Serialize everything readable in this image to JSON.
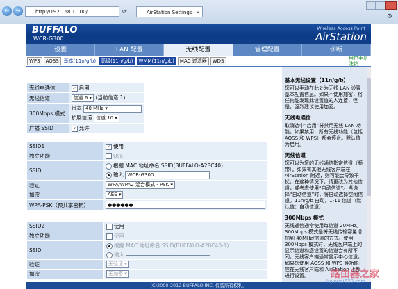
{
  "browser": {
    "back": "←",
    "forward": "→",
    "address": "http://192.168.1.100/",
    "tab_title": "AirStation Settings",
    "tab_close": "×"
  },
  "header": {
    "brand": "BUFFALO",
    "model": "WCR-G300",
    "product_sub": "Wireless Access Point",
    "product": "AirStation"
  },
  "tabs": [
    "设置",
    "LAN 配置",
    "无线配置",
    "管理配置",
    "诊断"
  ],
  "subtabs": [
    "WPS",
    "AOSS",
    "基本(11n/g/b)",
    "高级(11n/g/b)",
    "WMM(11n/g/b)",
    "MAC 过滤器",
    "WDS"
  ],
  "manual": {
    "line1": "用户手册",
    "line2": "注销"
  },
  "form": {
    "wireless_label": "无线电通信",
    "wireless_value": "启用",
    "channel_label": "无线信道",
    "channel_value": "信道 6",
    "channel_current": "(当前信道 1)",
    "mode300_label": "300Mbps 模式",
    "bandwidth_label": "带宽",
    "bandwidth_value": "40 MHz",
    "ext_channel_label": "扩展信道",
    "ext_channel_value": "信道 10",
    "broadcast_label": "广播 SSID",
    "broadcast_value": "允许",
    "ssid1_label": "SSID1",
    "ssid1_use": "使用",
    "isolation_label": "独立功能",
    "isolation_value": "Use",
    "ssid_label": "SSID",
    "ssid_opt_mac": "根据 MAC 地址命名 SSID(BUFFALO-A28C40)",
    "ssid_opt_input": "输入",
    "ssid_value": "WCR-G300",
    "auth_label": "验证",
    "auth_value": "WPA/WPA2 混合模式 - PSK",
    "enc_label": "加密",
    "enc_value": "AES",
    "psk_label": "WPA-PSK（预共享密钥）",
    "psk_value": "●●●●●●",
    "ssid2_label": "SSID2",
    "ssid2_use": "使用",
    "isolation2_label": "独立功能",
    "isolation2_value": "使用",
    "ssid2_opt_mac": "根据 MAC 地址命名 SSID(BUFFALO-A28C40-1)",
    "ssid2_opt_input": "输入",
    "auth2_label": "验证",
    "auth2_value": "无验证",
    "enc2_label": "加密",
    "enc2_value": "无加密"
  },
  "help": {
    "title": "基本无线设置（11n/g/b）",
    "p1": "您可以手动在此处为无线 LAN 设置基本配置信息。如果不使用加密，将任何能发现此设置值的人连接，但是，强烈建议使用加密。",
    "h2": "无线电通信",
    "p2": "取消选中“启用”将禁用无线 LAN 功能。如果禁用，所有无线功能（包括 AOSS 和 WPS）都会停止。默认值为启用。",
    "h3": "无线信道",
    "p3": "您可以为您的无线通信指定信道（频带）。如果有其他无线客户端在 AirStation 附近，则可能会导致干扰。在这种情况下，请更改为其他信道，或考虑使用“自动信道”。当选择“自动信道”时，将自动选择空闲信道。11n/g/b 自动，1-11 信道（默认值：自动信道）",
    "h4": "300Mbps 模式",
    "p4": "无线通信通常使用每信道 20MHz。300Mbps 模式是将无线传输容量增加到 40MHz/信道的方式。使用 300Mbps 模式时，无线客户端上的显示信道和您设置的信道会有所不同。无线客户端通常显示中心信道。如果您使用 AOSS 和 WPS 等功能，应在无线客户端和 AirStation 上都进行设置。"
  },
  "footer": "(C)2000-2012 BUFFALO INC. 保留所有权利。",
  "watermark": {
    "line1": "路由器之家",
    "line2": "luyouqi520.com"
  }
}
